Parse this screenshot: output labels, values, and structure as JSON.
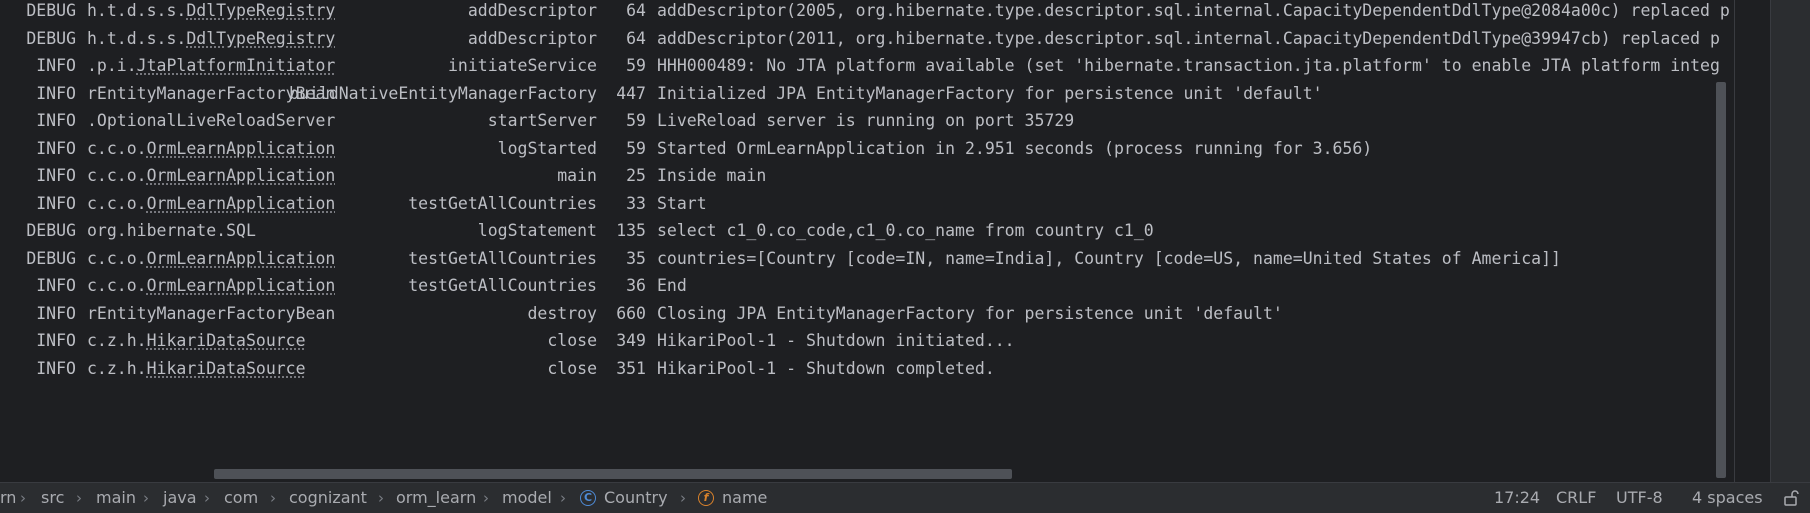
{
  "console": {
    "rows": [
      {
        "level": "DEBUG",
        "logger_prefix": "h.t.d.s.s.",
        "logger_link": "DdlTypeRegistry",
        "method": "addDescriptor",
        "line": "64",
        "message": "addDescriptor(2005, org.hibernate.type.descriptor.sql.internal.CapacityDependentDdlType@2084a00c) replaced p"
      },
      {
        "level": "DEBUG",
        "logger_prefix": "h.t.d.s.s.",
        "logger_link": "DdlTypeRegistry",
        "method": "addDescriptor",
        "line": "64",
        "message": "addDescriptor(2011, org.hibernate.type.descriptor.sql.internal.CapacityDependentDdlType@39947cb) replaced p"
      },
      {
        "level": "INFO",
        "logger_prefix": ".p.i.",
        "logger_link": "JtaPlatformInitiator",
        "method": "initiateService",
        "line": "59",
        "message": "HHH000489: No JTA platform available (set 'hibernate.transaction.jta.platform' to enable JTA platform integ"
      },
      {
        "level": "INFO",
        "logger_prefix": "rEntityManagerFactoryBean",
        "logger_link": "",
        "method": "buildNativeEntityManagerFactory",
        "line": "447",
        "message": "Initialized JPA EntityManagerFactory for persistence unit 'default'"
      },
      {
        "level": "INFO",
        "logger_prefix": ".OptionalLiveReloadServer",
        "logger_link": "",
        "method": "startServer",
        "line": "59",
        "message": "LiveReload server is running on port 35729"
      },
      {
        "level": "INFO",
        "logger_prefix": "c.c.o.",
        "logger_link": "OrmLearnApplication",
        "method": "logStarted",
        "line": "59",
        "message": "Started OrmLearnApplication in 2.951 seconds (process running for 3.656)"
      },
      {
        "level": "INFO",
        "logger_prefix": "c.c.o.",
        "logger_link": "OrmLearnApplication",
        "method": "main",
        "line": "25",
        "message": "Inside main"
      },
      {
        "level": "INFO",
        "logger_prefix": "c.c.o.",
        "logger_link": "OrmLearnApplication",
        "method": "testGetAllCountries",
        "line": "33",
        "message": "Start"
      },
      {
        "level": "DEBUG",
        "logger_prefix": "org.hibernate.SQL",
        "logger_link": "",
        "method": "logStatement",
        "line": "135",
        "message": "select c1_0.co_code,c1_0.co_name from country c1_0"
      },
      {
        "level": "DEBUG",
        "logger_prefix": "c.c.o.",
        "logger_link": "OrmLearnApplication",
        "method": "testGetAllCountries",
        "line": "35",
        "message": "countries=[Country [code=IN, name=India], Country [code=US, name=United States of America]]"
      },
      {
        "level": "INFO",
        "logger_prefix": "c.c.o.",
        "logger_link": "OrmLearnApplication",
        "method": "testGetAllCountries",
        "line": "36",
        "message": "End"
      },
      {
        "level": "INFO",
        "logger_prefix": "rEntityManagerFactoryBean",
        "logger_link": "",
        "method": "destroy",
        "line": "660",
        "message": "Closing JPA EntityManagerFactory for persistence unit 'default'"
      },
      {
        "level": "INFO",
        "logger_prefix": "c.z.h.",
        "logger_link": "HikariDataSource",
        "method": "close",
        "line": "349",
        "message": "HikariPool-1 - Shutdown initiated..."
      },
      {
        "level": "INFO",
        "logger_prefix": "c.z.h.",
        "logger_link": "HikariDataSource",
        "method": "close",
        "line": "351",
        "message": "HikariPool-1 - Shutdown completed."
      }
    ]
  },
  "breadcrumb": {
    "items": [
      "rn",
      "src",
      "main",
      "java",
      "com",
      "cognizant",
      "orm_learn",
      "model",
      "Country",
      "name"
    ],
    "class_icon_glyph": "C",
    "field_icon_glyph": "f"
  },
  "status": {
    "position": "17:24",
    "line_separator": "CRLF",
    "encoding": "UTF-8",
    "indent": "4 spaces"
  },
  "colors": {
    "text": "#bcbec4",
    "background": "#1e1f22",
    "class_icon": "#4e8bd6",
    "field_icon": "#d9822b"
  }
}
